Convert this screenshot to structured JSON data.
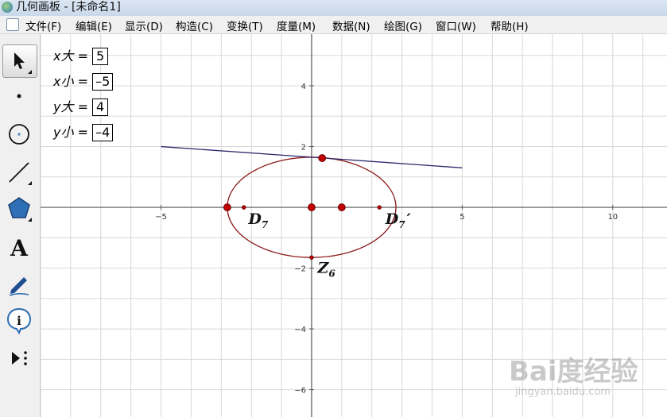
{
  "app": {
    "title": "几何画板 - [未命名1]"
  },
  "menu": {
    "items": [
      "文件(F)",
      "编辑(E)",
      "显示(D)",
      "构造(C)",
      "变换(T)",
      "度量(M)",
      "数据(N)",
      "绘图(G)",
      "窗口(W)",
      "帮助(H)"
    ]
  },
  "toolbar": {
    "tools": [
      "arrow-select-tool",
      "point-tool",
      "compass-tool",
      "straightedge-tool",
      "polygon-tool",
      "text-tool",
      "marker-tool",
      "information-tool",
      "custom-tools"
    ],
    "text_tool_glyph": "A"
  },
  "parameters": [
    {
      "var": "x",
      "word": "大",
      "eq": " = ",
      "value": "5"
    },
    {
      "var": "x",
      "word": "小",
      "eq": " = ",
      "value": "–5"
    },
    {
      "var": "y",
      "word": "大",
      "eq": " = ",
      "value": "4"
    },
    {
      "var": "y",
      "word": "小",
      "eq": " = ",
      "value": "–4"
    }
  ],
  "chart_data": {
    "type": "scatter",
    "xlim": [
      -9,
      11.8
    ],
    "ylim": [
      -6.9,
      5.7
    ],
    "grid": true,
    "x_ticks": [
      -5,
      5,
      10
    ],
    "x_tick_labels": [
      "−5",
      "5",
      "10"
    ],
    "y_ticks": [
      4,
      2,
      -2,
      -4,
      -6
    ],
    "y_tick_labels": [
      "4",
      "2",
      "−2",
      "−4",
      "−6"
    ],
    "ellipse": {
      "cx": 0,
      "cy": 0,
      "rx": 2.8,
      "ry": 1.65,
      "color": "#8b1a1a"
    },
    "line": {
      "x1": -5,
      "y1": 2.0,
      "x2": 5,
      "y2": 1.3,
      "color": "#2a2a6a"
    },
    "points": [
      {
        "x": -2.8,
        "y": 0,
        "size": "large"
      },
      {
        "x": -2.25,
        "y": 0,
        "size": "small"
      },
      {
        "x": 0,
        "y": 0,
        "size": "large"
      },
      {
        "x": 1.0,
        "y": 0,
        "size": "large"
      },
      {
        "x": 2.25,
        "y": 0,
        "size": "small"
      },
      {
        "x": 0.35,
        "y": 1.62,
        "size": "large"
      },
      {
        "x": 0,
        "y": -1.65,
        "size": "small"
      }
    ],
    "labels": [
      {
        "text": "D",
        "sub": "7",
        "prime": "",
        "x": -2.1,
        "y": -0.55
      },
      {
        "text": "D",
        "sub": "7",
        "prime": "′",
        "x": 2.45,
        "y": -0.55
      },
      {
        "text": "Z",
        "sub": "6",
        "prime": "",
        "x": 0.2,
        "y": -2.15
      }
    ],
    "point_color": "#c00000"
  },
  "watermark": {
    "logo": "Bai度经验",
    "url": "jingyan.baidu.com"
  }
}
